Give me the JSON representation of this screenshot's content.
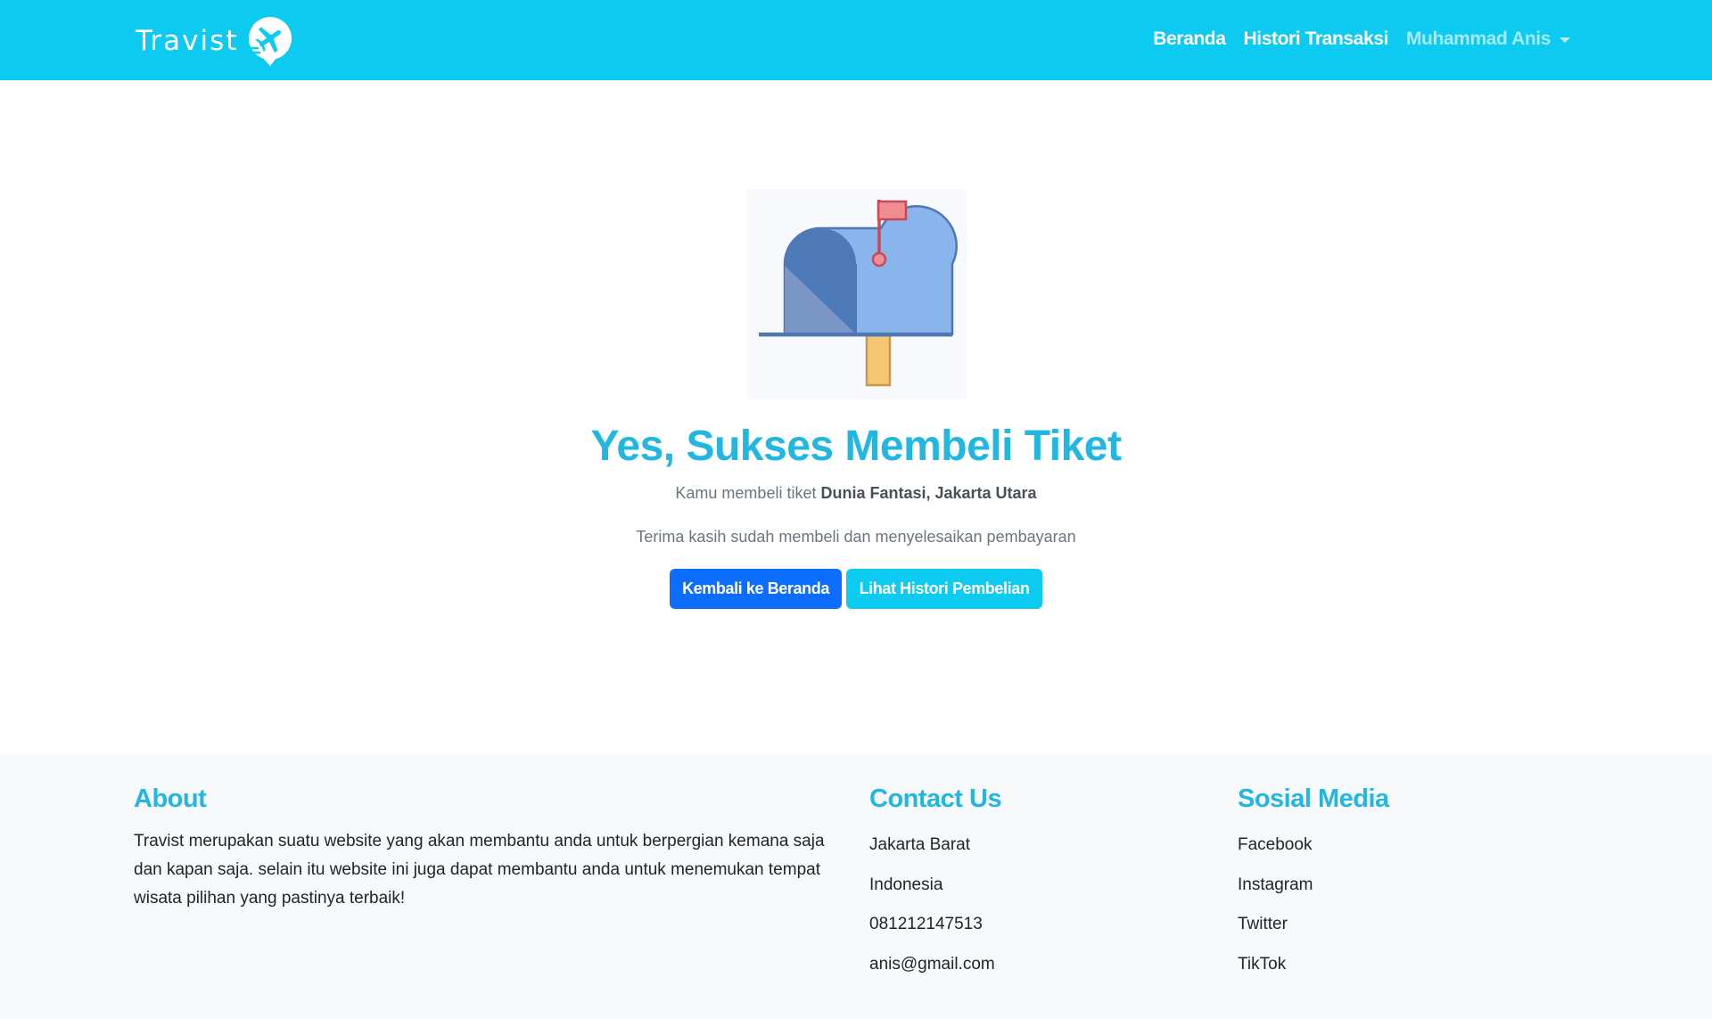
{
  "navbar": {
    "brand": "Travist",
    "links": [
      {
        "label": "Beranda"
      },
      {
        "label": "Histori Transaksi"
      }
    ],
    "user": {
      "label": "Muhammad Anis"
    }
  },
  "hero": {
    "title": "Yes, Sukses Membeli Tiket",
    "subtitle_prefix": "Kamu membeli tiket ",
    "ticket_name": "Dunia Fantasi, Jakarta Utara",
    "thanks": "Terima kasih sudah membeli dan menyelesaikan pembayaran",
    "primary_button": "Kembali ke Beranda",
    "secondary_button": "Lihat Histori Pembelian"
  },
  "footer": {
    "about": {
      "title": "About",
      "text": "Travist merupakan suatu website yang akan membantu anda untuk berpergian kemana saja dan kapan saja. selain itu website ini juga dapat membantu anda untuk menemukan tempat wisata pilihan yang pastinya terbaik!"
    },
    "contact": {
      "title": "Contact Us",
      "items": [
        "Jakarta Barat",
        "Indonesia",
        "081212147513",
        "anis@gmail.com"
      ]
    },
    "social": {
      "title": "Sosial Media",
      "items": [
        "Facebook",
        "Instagram",
        "Twitter",
        "TikTok"
      ]
    }
  },
  "colors": {
    "navbar": "#0dcaf0",
    "accent_heading": "#21b7e0",
    "primary_button": "#0d6efd",
    "info_button": "#0dcaf0",
    "footer_bg": "#f8f9fa"
  },
  "icons": {
    "brand_logo": "airplane-pin-icon",
    "hero_illustration": "mailbox-icon",
    "user_menu": "caret-down-icon"
  }
}
